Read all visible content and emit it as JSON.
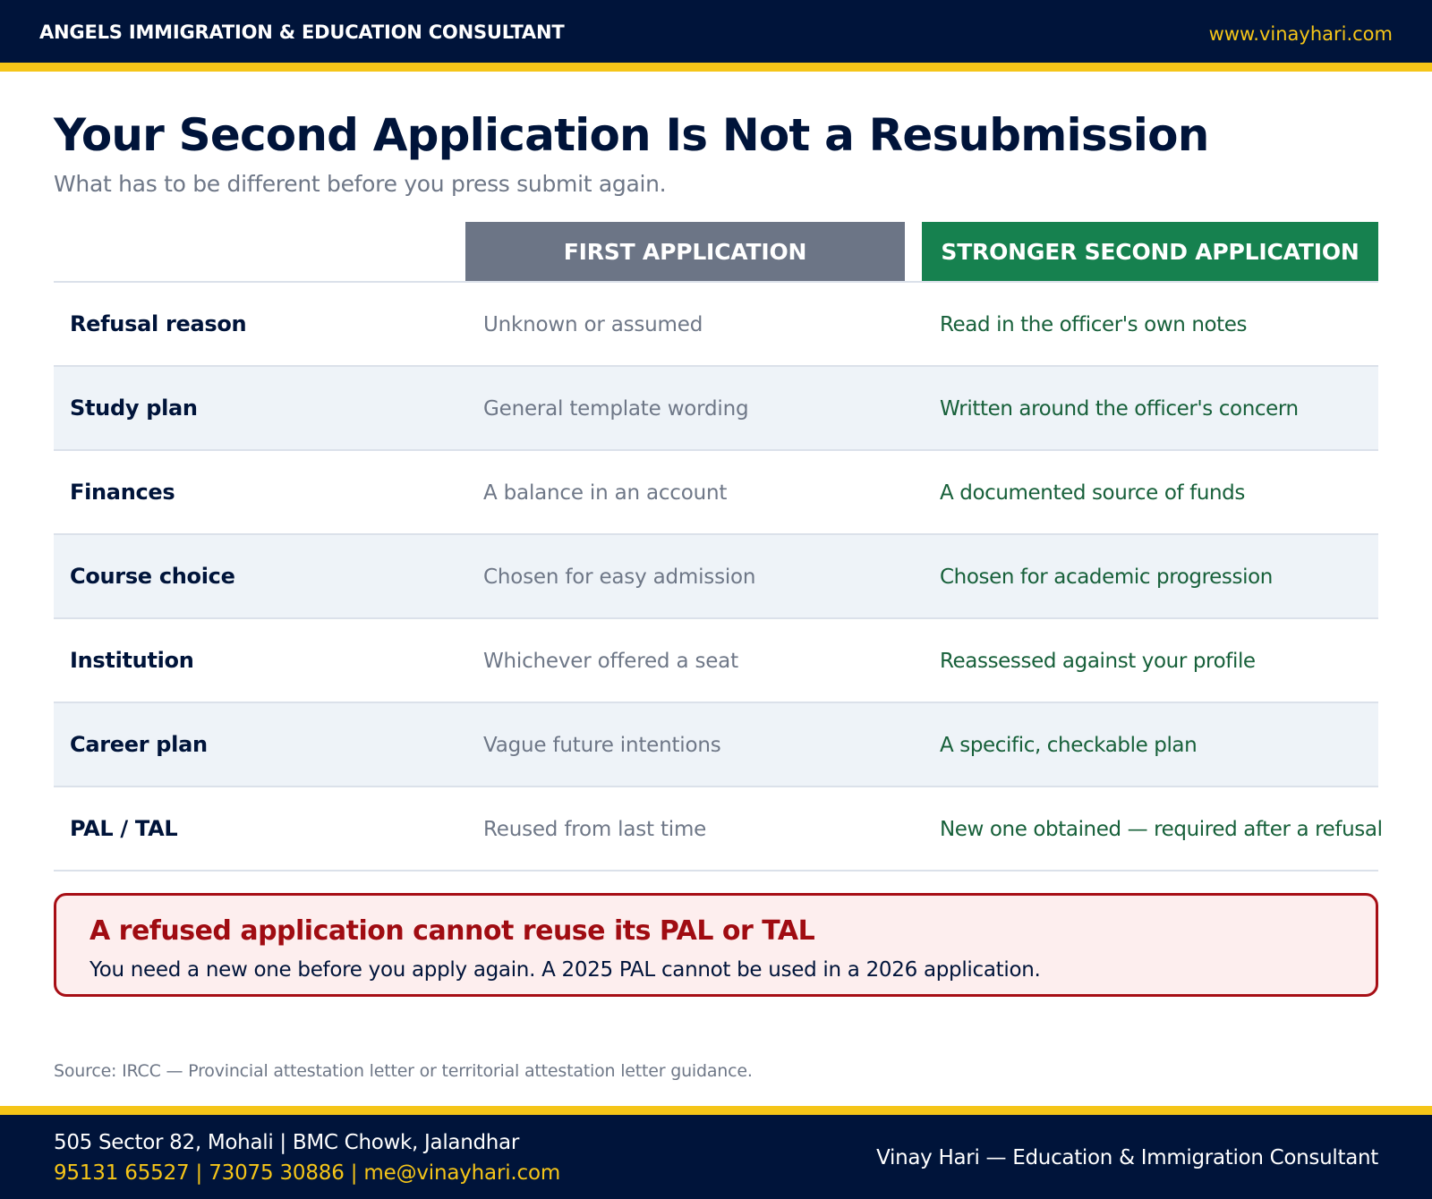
{
  "header": {
    "brand": "ANGELS IMMIGRATION & EDUCATION CONSULTANT",
    "url": "www.vinayhari.com"
  },
  "title": "Your Second Application Is Not a Resubmission",
  "subtitle": "What has to be different before you press submit again.",
  "table": {
    "columns": [
      "FIRST APPLICATION",
      "STRONGER SECOND APPLICATION"
    ],
    "rows": [
      {
        "label": "Refusal reason",
        "first": "Unknown or assumed",
        "second": "Read in the officer's own notes"
      },
      {
        "label": "Study plan",
        "first": "General template wording",
        "second": "Written around the officer's concern"
      },
      {
        "label": "Finances",
        "first": "A balance in an account",
        "second": "A documented source of funds"
      },
      {
        "label": "Course choice",
        "first": "Chosen for easy admission",
        "second": "Chosen for academic progression"
      },
      {
        "label": "Institution",
        "first": "Whichever offered a seat",
        "second": "Reassessed against your profile"
      },
      {
        "label": "Career plan",
        "first": "Vague future intentions",
        "second": "A specific, checkable plan"
      },
      {
        "label": "PAL / TAL",
        "first": "Reused from last time",
        "second": "New one obtained — required after a refusal"
      }
    ]
  },
  "warning": {
    "title": "A refused application cannot reuse its PAL or TAL",
    "text": "You need a new one before you apply again. A 2025 PAL cannot be used in a 2026 application."
  },
  "source": "Source: IRCC — Provincial attestation letter or territorial attestation letter guidance.",
  "footer": {
    "address": "505 Sector 82, Mohali  |  BMC Chowk, Jalandhar",
    "contact": "95131 65527  |  73075 30886  |  me@vinayhari.com",
    "tagline": "Vinay Hari  —  Education & Immigration Consultant"
  },
  "colors": {
    "navy": "#00143a",
    "gold": "#f5c518",
    "first_header": "#6c7586",
    "second_header": "#16814f",
    "second_text": "#17603a",
    "warning_red": "#a70e15",
    "warning_bg": "#fdeeee"
  }
}
